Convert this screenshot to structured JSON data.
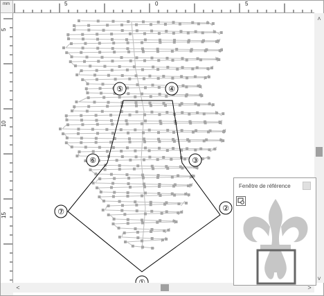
{
  "rulers": {
    "unit": "mm",
    "horizontal_labels": [
      "5",
      "0",
      "5"
    ],
    "vertical_labels": [
      "5",
      "10",
      "15"
    ]
  },
  "callouts": [
    "①",
    "②",
    "③",
    "④",
    "⑤",
    "⑥",
    "⑦"
  ],
  "reference_window": {
    "title": "Fenêtre de référence",
    "view_button_icon": "view-icon"
  },
  "scrollbars": {
    "up_arrow": "˄",
    "down_arrow": "˅",
    "left_arrow": "<",
    "right_arrow": ">"
  },
  "colors": {
    "stitch_line": "#bdbdbd",
    "stitch_point": "#a6a6a6",
    "outline": "#000000",
    "reference_shape": "#c6c6c6",
    "reference_frame": "#666666"
  }
}
